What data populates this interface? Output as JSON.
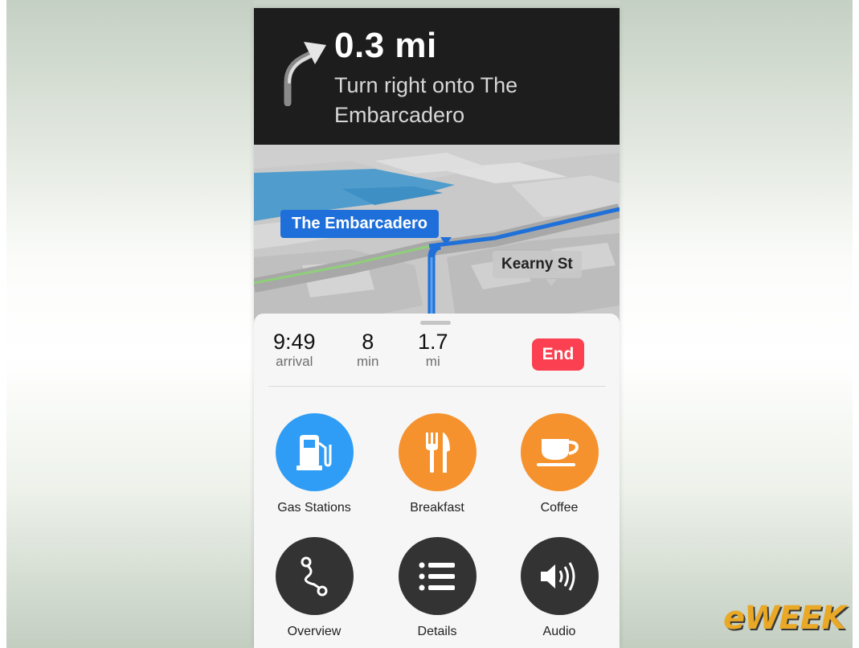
{
  "navigation": {
    "distance": "0.3 mi",
    "instruction": "Turn right onto The Embarcadero",
    "turn_icon": "turn-right-arrow-icon"
  },
  "map": {
    "road_label": "The Embarcadero",
    "street_label": "Kearny St"
  },
  "trip": {
    "arrival_value": "9:49",
    "arrival_unit": "arrival",
    "minutes_value": "8",
    "minutes_unit": "min",
    "miles_value": "1.7",
    "miles_unit": "mi",
    "end_label": "End"
  },
  "actions": [
    {
      "label": "Gas Stations",
      "icon": "gas-pump-icon",
      "color": "#2f9df5"
    },
    {
      "label": "Breakfast",
      "icon": "fork-knife-icon",
      "color": "#f5922d"
    },
    {
      "label": "Coffee",
      "icon": "coffee-cup-icon",
      "color": "#f5922d"
    },
    {
      "label": "Overview",
      "icon": "route-overview-icon",
      "color": "#333333"
    },
    {
      "label": "Details",
      "icon": "list-icon",
      "color": "#333333"
    },
    {
      "label": "Audio",
      "icon": "speaker-icon",
      "color": "#333333"
    }
  ],
  "logo": "eWEEK"
}
